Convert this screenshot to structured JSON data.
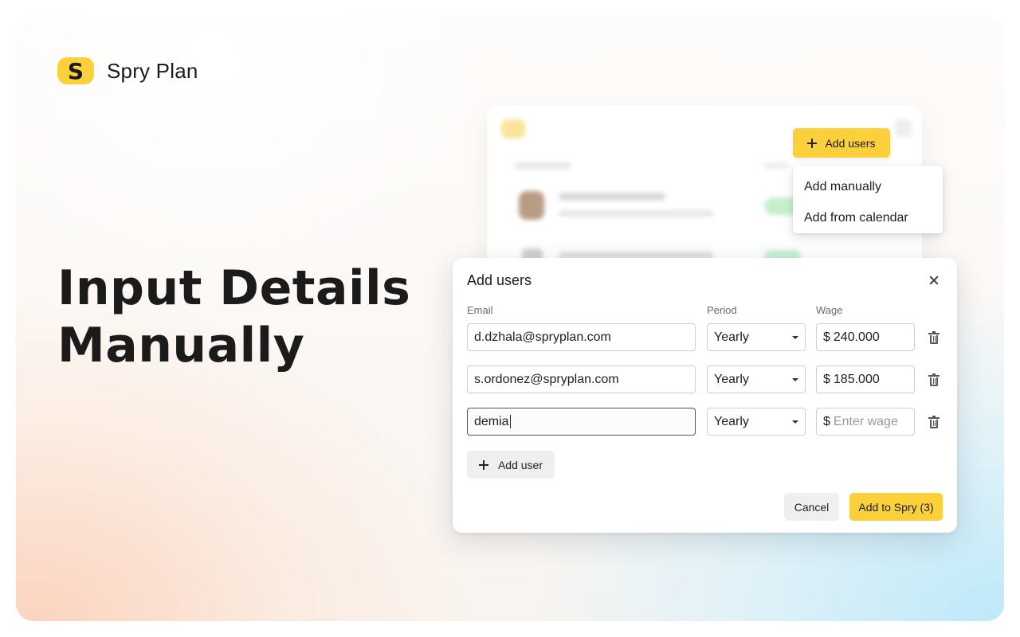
{
  "brand": {
    "logo_letter": "S",
    "name": "Spry Plan",
    "accent_color": "#fcd03b"
  },
  "hero": {
    "title": "Input Details Manually"
  },
  "toolbar": {
    "add_users_label": "Add users"
  },
  "menu": {
    "items": [
      "Add manually",
      "Add from calendar"
    ]
  },
  "dialog": {
    "title": "Add users",
    "columns": {
      "email": "Email",
      "period": "Period",
      "wage": "Wage"
    },
    "currency_symbol": "$",
    "rows": [
      {
        "email": "d.dzhala@spryplan.com",
        "period": "Yearly",
        "wage": "240.000",
        "wage_placeholder": ""
      },
      {
        "email": "s.ordonez@spryplan.com",
        "period": "Yearly",
        "wage": "185.000",
        "wage_placeholder": ""
      },
      {
        "email": "demia",
        "period": "Yearly",
        "wage": "",
        "wage_placeholder": "Enter wage"
      }
    ],
    "add_user_label": "Add user",
    "cancel_label": "Cancel",
    "submit_label": "Add to Spry (3)"
  }
}
